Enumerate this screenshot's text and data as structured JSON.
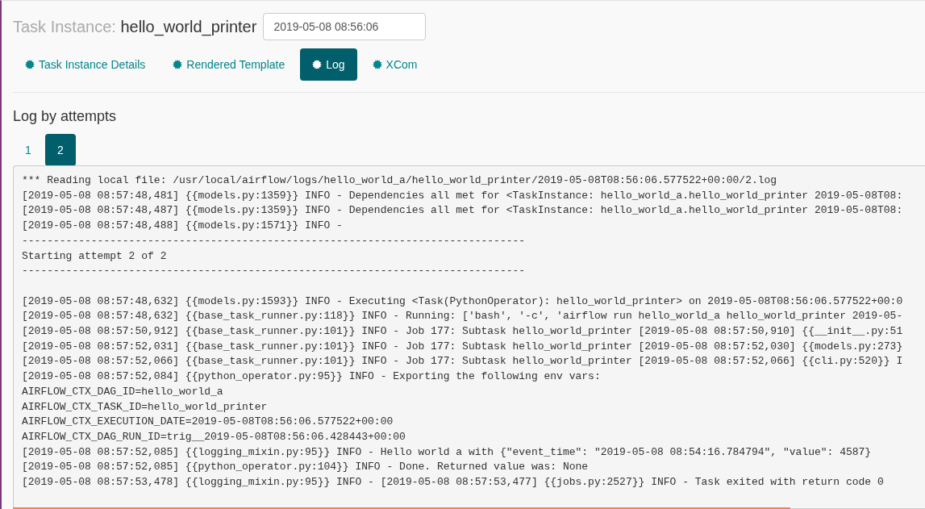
{
  "header": {
    "label": "Task Instance:",
    "task": "hello_world_printer",
    "date_field": {
      "value": "2019-05-08 08:56:06"
    }
  },
  "tabs": [
    {
      "label": "Task Instance Details",
      "selected": false
    },
    {
      "label": "Rendered Template",
      "selected": false
    },
    {
      "label": "Log",
      "selected": true
    },
    {
      "label": "XCom",
      "selected": false
    }
  ],
  "section_title": "Log by attempts",
  "attempts": [
    {
      "label": "1",
      "selected": false
    },
    {
      "label": "2",
      "selected": true
    }
  ],
  "log_lines": [
    "*** Reading local file: /usr/local/airflow/logs/hello_world_a/hello_world_printer/2019-05-08T08:56:06.577522+00:00/2.log",
    "[2019-05-08 08:57:48,481] {{models.py:1359}} INFO - Dependencies all met for <TaskInstance: hello_world_a.hello_world_printer 2019-05-08T08:",
    "[2019-05-08 08:57:48,487] {{models.py:1359}} INFO - Dependencies all met for <TaskInstance: hello_world_a.hello_world_printer 2019-05-08T08:",
    "[2019-05-08 08:57:48,488] {{models.py:1571}} INFO -",
    "--------------------------------------------------------------------------------",
    "Starting attempt 2 of 2",
    "--------------------------------------------------------------------------------",
    {
      "kind": "blank"
    },
    "[2019-05-08 08:57:48,632] {{models.py:1593}} INFO - Executing <Task(PythonOperator): hello_world_printer> on 2019-05-08T08:56:06.577522+00:0",
    "[2019-05-08 08:57:48,632] {{base_task_runner.py:118}} INFO - Running: ['bash', '-c', 'airflow run hello_world_a hello_world_printer 2019-05-",
    "[2019-05-08 08:57:50,912] {{base_task_runner.py:101}} INFO - Job 177: Subtask hello_world_printer [2019-05-08 08:57:50,910] {{__init__.py:51",
    "[2019-05-08 08:57:52,031] {{base_task_runner.py:101}} INFO - Job 177: Subtask hello_world_printer [2019-05-08 08:57:52,030] {{models.py:273}",
    "[2019-05-08 08:57:52,066] {{base_task_runner.py:101}} INFO - Job 177: Subtask hello_world_printer [2019-05-08 08:57:52,066] {{cli.py:520}} I",
    "[2019-05-08 08:57:52,084] {{python_operator.py:95}} INFO - Exporting the following env vars:",
    "AIRFLOW_CTX_DAG_ID=hello_world_a",
    "AIRFLOW_CTX_TASK_ID=hello_world_printer",
    "AIRFLOW_CTX_EXECUTION_DATE=2019-05-08T08:56:06.577522+00:00",
    "AIRFLOW_CTX_DAG_RUN_ID=trig__2019-05-08T08:56:06.428443+00:00",
    "[2019-05-08 08:57:52,085] {{logging_mixin.py:95}} INFO - Hello world a with {\"event_time\": \"2019-05-08 08:54:16.784794\", \"value\": 4587}",
    "[2019-05-08 08:57:52,085] {{python_operator.py:104}} INFO - Done. Returned value was: None",
    "[2019-05-08 08:57:53,478] {{logging_mixin.py:95}} INFO - [2019-05-08 08:57:53,477] {{jobs.py:2527}} INFO - Task exited with return code 0"
  ]
}
